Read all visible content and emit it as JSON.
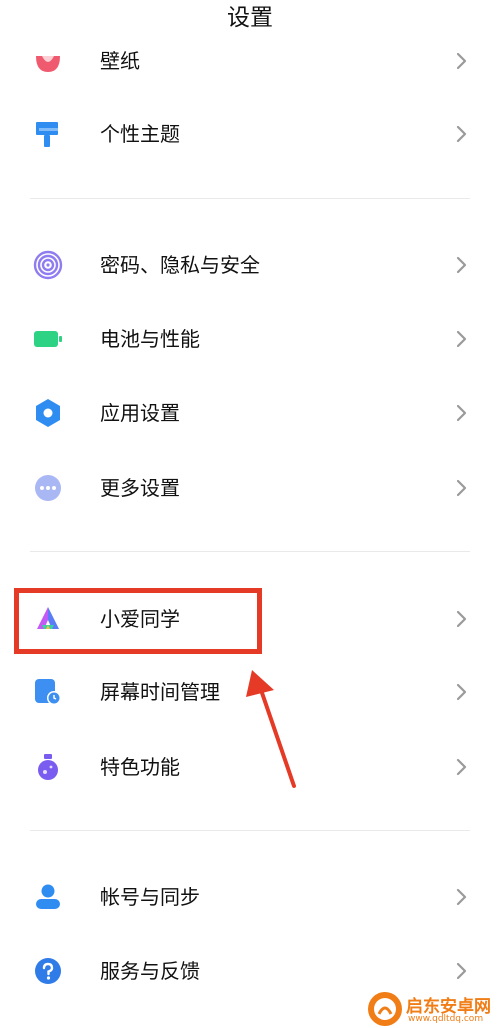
{
  "header": {
    "title": "设置"
  },
  "items": [
    {
      "label": "壁纸",
      "icon": "wallpaper-icon"
    },
    {
      "label": "个性主题",
      "icon": "theme-brush-icon"
    },
    {
      "label": "密码、隐私与安全",
      "icon": "fingerprint-icon"
    },
    {
      "label": "电池与性能",
      "icon": "battery-icon"
    },
    {
      "label": "应用设置",
      "icon": "gear-icon"
    },
    {
      "label": "更多设置",
      "icon": "more-dots-icon"
    },
    {
      "label": "小爱同学",
      "icon": "xiaoai-assistant-icon"
    },
    {
      "label": "屏幕时间管理",
      "icon": "screen-time-icon"
    },
    {
      "label": "特色功能",
      "icon": "flask-icon"
    },
    {
      "label": "帐号与同步",
      "icon": "account-icon"
    },
    {
      "label": "服务与反馈",
      "icon": "help-icon"
    }
  ],
  "watermark": {
    "title": "启东安卓网",
    "url": "www.qdltdq.com"
  },
  "colors": {
    "highlight": "#e53a26",
    "chevron": "#9a9a9a",
    "divider": "#e9e9e9",
    "watermark": "#f07d16"
  }
}
